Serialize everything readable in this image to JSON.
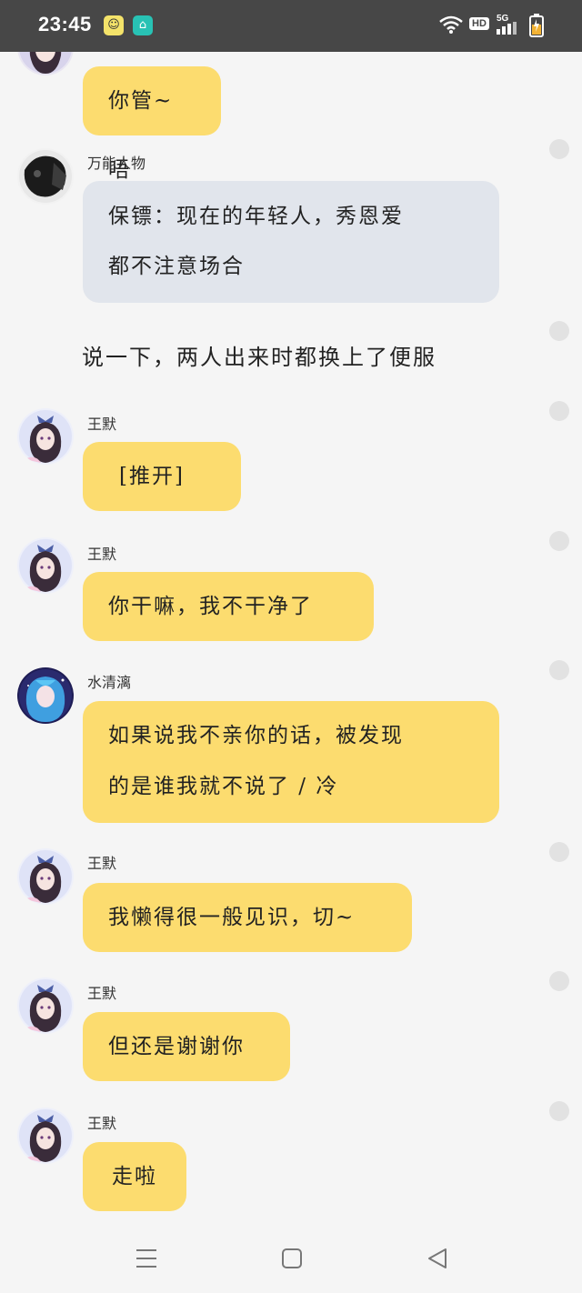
{
  "status_bar": {
    "time": "23:45",
    "hd_label": "HD",
    "network_label": "5G"
  },
  "messages": [
    {
      "type": "bubble",
      "style": "yellow",
      "avatar": "girl",
      "name": "",
      "lines": [
        "你管~唔"
      ]
    },
    {
      "type": "bubble",
      "style": "grey",
      "avatar": "dark",
      "name": "万能人物",
      "lines": [
        "保镖：现在的年轻人，秀恩爱",
        "都不注意场合"
      ]
    },
    {
      "type": "narration",
      "lines": [
        "说一下，两人出来时都换上了便服"
      ]
    },
    {
      "type": "bubble",
      "style": "yellow",
      "avatar": "girl",
      "name": "王默",
      "lines": [
        "[推开]"
      ]
    },
    {
      "type": "bubble",
      "style": "yellow",
      "avatar": "girl",
      "name": "王默",
      "lines": [
        "你干嘛，我不干净了"
      ]
    },
    {
      "type": "bubble",
      "style": "yellow",
      "avatar": "blue",
      "name": "水清漓",
      "lines": [
        "如果说我不亲你的话，被发现",
        "的是谁我就不说了 / 冷"
      ]
    },
    {
      "type": "bubble",
      "style": "yellow",
      "avatar": "girl",
      "name": "王默",
      "lines": [
        "我懒得很一般见识，切~"
      ]
    },
    {
      "type": "bubble",
      "style": "yellow",
      "avatar": "girl",
      "name": "王默",
      "lines": [
        "但还是谢谢你"
      ]
    },
    {
      "type": "bubble",
      "style": "yellow",
      "avatar": "girl",
      "name": "王默",
      "lines": [
        "走啦"
      ]
    }
  ],
  "colors": {
    "status_bar": "#474747",
    "yellow_bubble": "#fcdc6f",
    "grey_bubble": "#e1e5ec",
    "background": "#f5f5f5"
  },
  "icons": {
    "nav_menu": "menu-icon",
    "nav_home": "home-icon",
    "nav_back": "back-icon"
  }
}
